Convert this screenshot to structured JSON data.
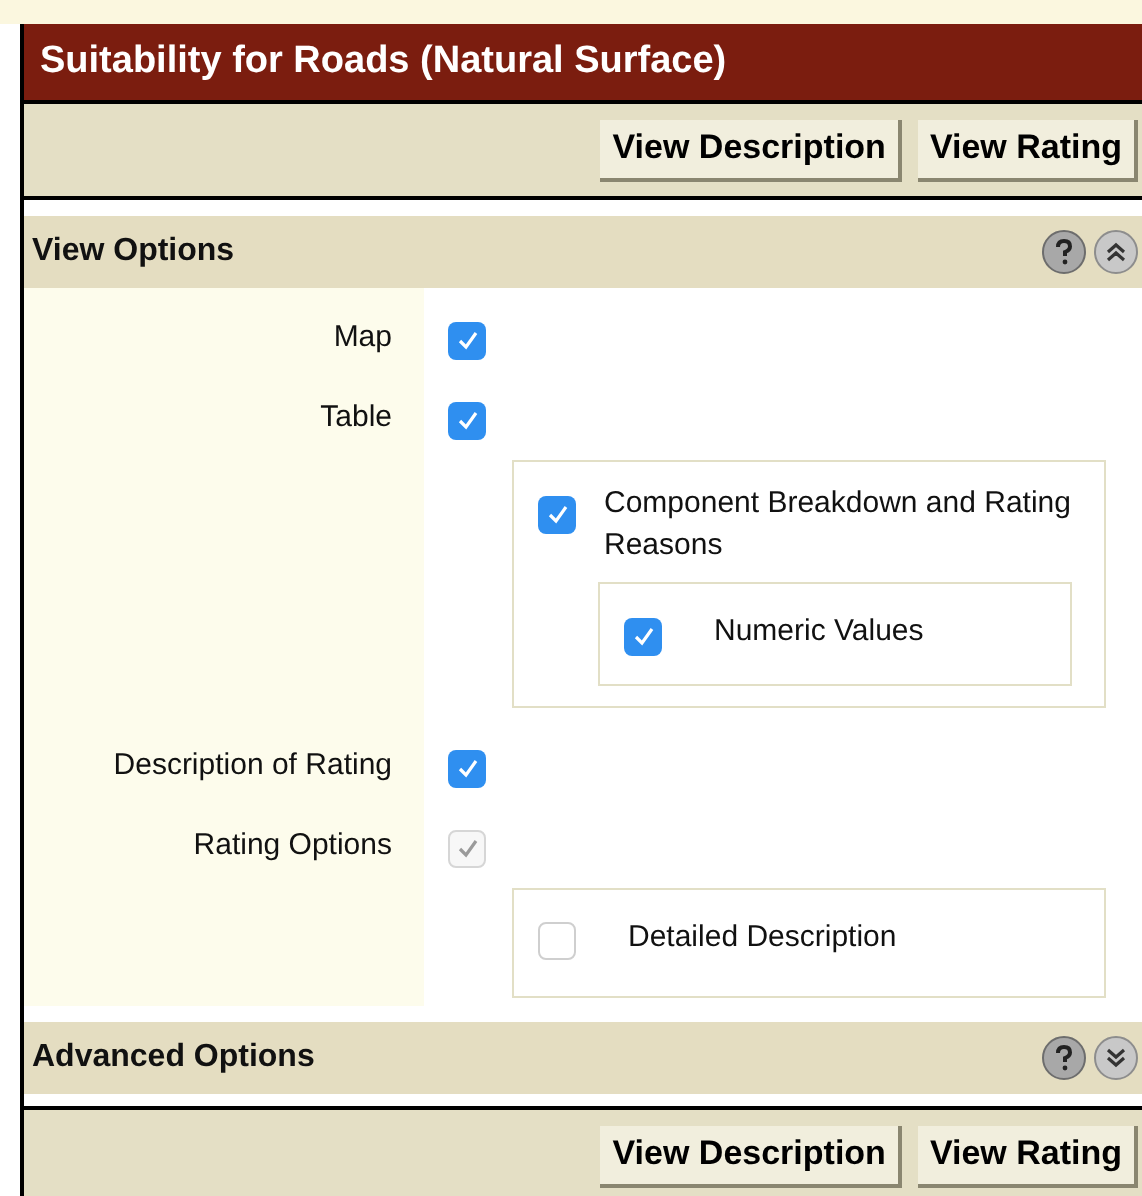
{
  "title": "Suitability for Roads (Natural Surface)",
  "top_buttons": [
    "View Description",
    "View Rating"
  ],
  "sections": [
    {
      "title": "View Options",
      "expanded": true,
      "options": [
        {
          "label": "Map",
          "checked": true,
          "disabled": false
        },
        {
          "label": "Table",
          "checked": true,
          "disabled": false,
          "children": [
            {
              "label": "Component Breakdown and Rating Reasons",
              "checked": true,
              "disabled": false,
              "children": [
                {
                  "label": "Numeric Values",
                  "checked": true,
                  "disabled": false
                }
              ]
            }
          ]
        },
        {
          "label": "Description of Rating",
          "checked": true,
          "disabled": false
        },
        {
          "label": "Rating Options",
          "checked": true,
          "disabled": true,
          "children": [
            {
              "label": "Detailed Description",
              "checked": false,
              "disabled": false
            }
          ]
        }
      ]
    },
    {
      "title": "Advanced Options",
      "expanded": false
    }
  ],
  "bottom_buttons": [
    "View Description",
    "View Rating"
  ]
}
